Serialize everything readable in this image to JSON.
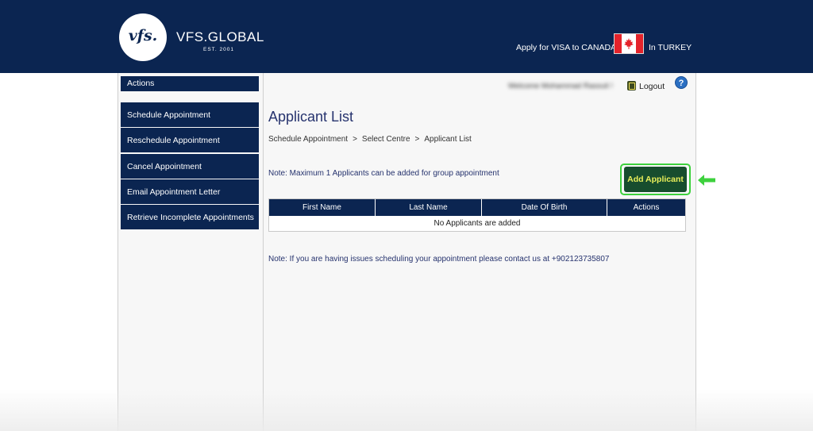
{
  "header": {
    "logo_mark": "vfs.",
    "brand_name": "VFS.GLOBAL",
    "brand_est": "EST. 2001",
    "apply_text": "Apply for VISA to CANADA",
    "country_text": "In TURKEY",
    "flag_icon": "canada-flag-icon"
  },
  "sidebar": {
    "title": "Actions",
    "items": [
      {
        "label": "Schedule Appointment"
      },
      {
        "label": "Reschedule Appointment"
      },
      {
        "label": "Cancel Appointment"
      },
      {
        "label": "Email Appointment Letter"
      },
      {
        "label": "Retrieve Incomplete Appointments"
      }
    ]
  },
  "topbar": {
    "welcome_text": "Welcome Mohammad Rasouli !",
    "logout_label": "Logout",
    "logout_icon": "logout-icon",
    "help_icon": "help-icon",
    "help_glyph": "?"
  },
  "main": {
    "title": "Applicant List",
    "breadcrumb": [
      "Schedule Appointment",
      "Select Centre",
      "Applicant List"
    ],
    "breadcrumb_sep": ">",
    "note_max": "Note: Maximum 1 Applicants can be added for group appointment",
    "add_button_label": "Add Applicant",
    "table": {
      "columns": [
        "First Name",
        "Last Name",
        "Date Of Birth",
        "Actions"
      ],
      "empty_message": "No Applicants are added"
    },
    "note_contact": "Note: If you are having issues scheduling your appointment please contact us at +902123735807"
  },
  "colors": {
    "navy": "#0b2551",
    "add_button_bg": "#174d2e",
    "add_button_text": "#e9ef5a",
    "highlight_green": "#3dd13d"
  }
}
